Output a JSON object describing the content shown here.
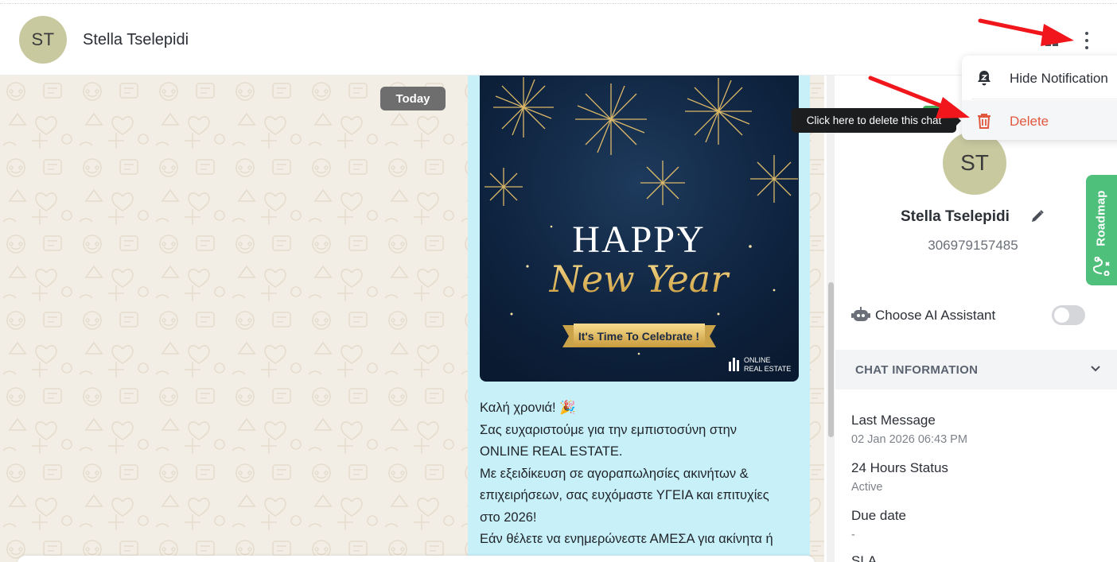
{
  "header": {
    "avatar_initials": "ST",
    "contact_name": "Stella Tselepidi",
    "book_icon": "book-icon",
    "menu_icon": "kebab-menu-icon"
  },
  "chat": {
    "date_chip": "Today",
    "image": {
      "headline": "HAPPY",
      "script_line": "New Year",
      "banner": "It's Time To Celebrate !",
      "brand_line1": "ONLINE",
      "brand_line2": "REAL ESTATE"
    },
    "message_lines": [
      "Καλή χρονιά! 🎉",
      "Σας ευχαριστούμε για την εμπιστοσύνη στην",
      "ONLINE REAL ESTATE.",
      "Με εξειδίκευση σε αγοραπωλησίες ακινήτων &",
      "επιχειρήσεων, σας ευχόμαστε ΥΓΕΙΑ και επιτυχίες",
      "στο 2026!",
      "Εάν θέλετε να ενημερώνεστε ΑΜΕΣΑ για ακίνητα ή"
    ]
  },
  "dropdown": {
    "items": [
      {
        "label": "Hide Notification",
        "icon": "bell-snooze-icon"
      },
      {
        "label": "Delete",
        "icon": "trash-icon"
      }
    ]
  },
  "tooltip": {
    "text": "Click here to delete this chat"
  },
  "panel": {
    "avatar_initials": "ST",
    "name": "Stella Tselepidi",
    "phone": "306979157485",
    "ai_label": "Choose AI Assistant",
    "ai_enabled": false,
    "section_title": "CHAT INFORMATION",
    "info": [
      {
        "label": "Last Message",
        "value": "02 Jan 2026 06:43 PM"
      },
      {
        "label": "24 Hours Status",
        "value": "Active"
      },
      {
        "label": "Due date",
        "value": "-"
      },
      {
        "label": "SLA",
        "value": ""
      }
    ]
  },
  "roadmap": {
    "label": "Roadmap"
  },
  "colors": {
    "accent_green": "#4fc07b",
    "bubble": "#c8f0f9",
    "delete_red": "#e2583e",
    "arrow_red": "#f0161b"
  }
}
